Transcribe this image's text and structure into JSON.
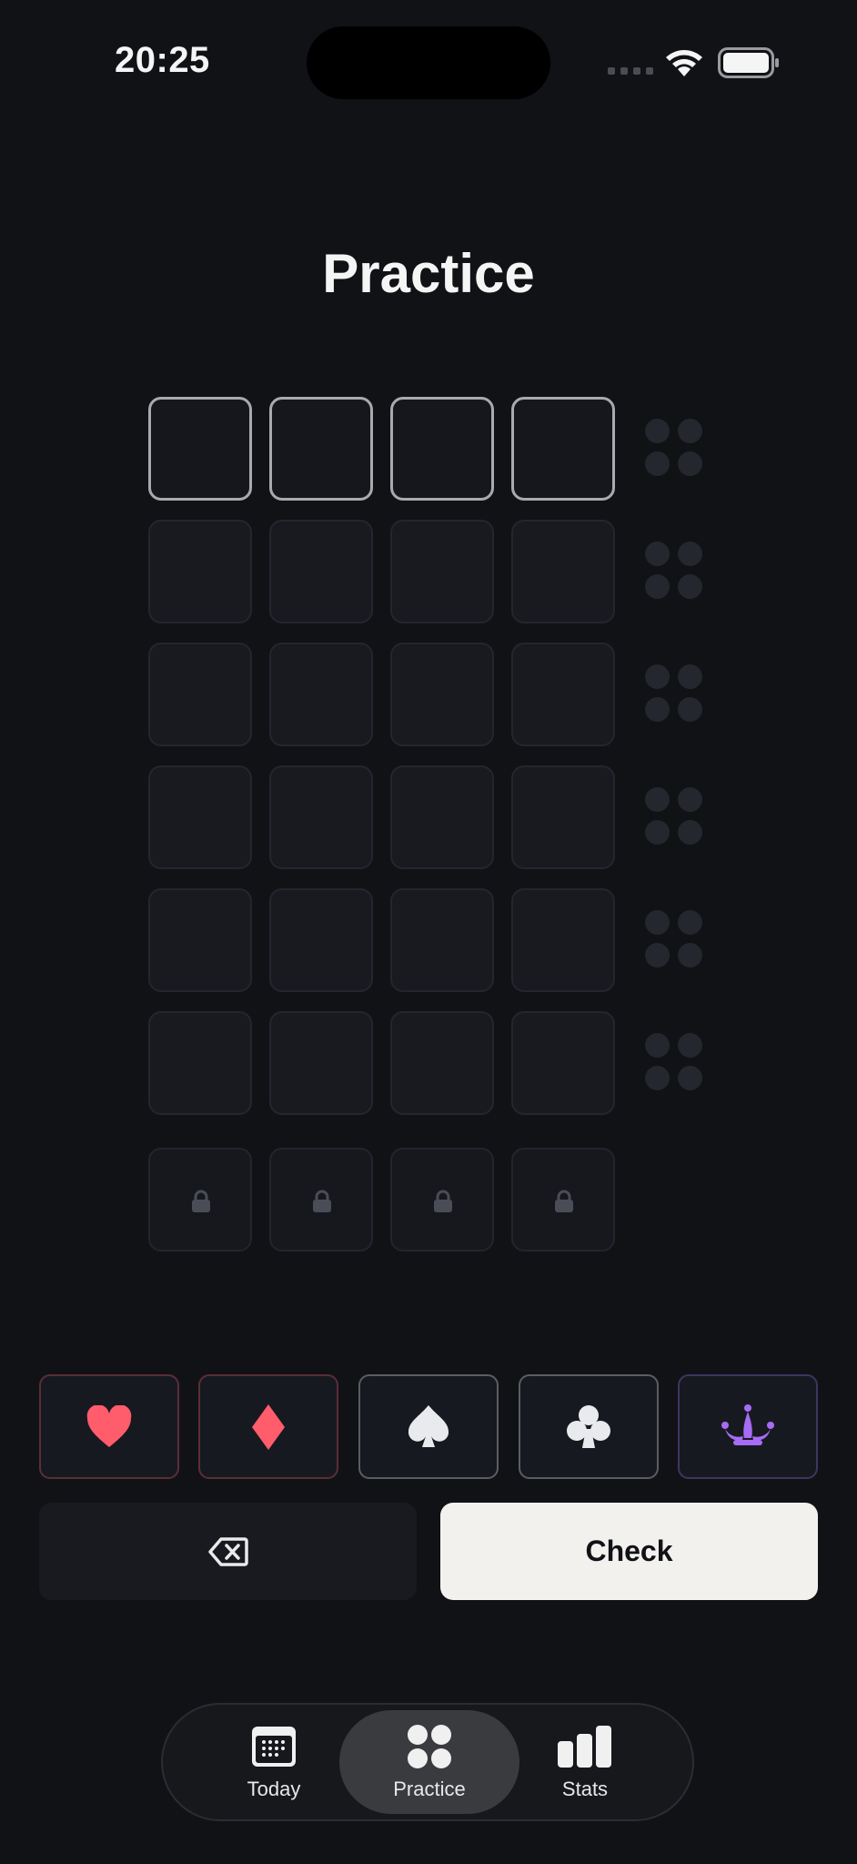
{
  "status_bar": {
    "time": "20:25"
  },
  "page": {
    "title": "Practice"
  },
  "board": {
    "rows": 6,
    "columns": 4,
    "active_row": 1,
    "locked_row_count": 4
  },
  "suits": [
    {
      "name": "heart",
      "color": "#ff5c6c"
    },
    {
      "name": "diamond",
      "color": "#ff5c6c"
    },
    {
      "name": "spade",
      "color": "#e9eaee"
    },
    {
      "name": "club",
      "color": "#e9eaee"
    },
    {
      "name": "joker-crown",
      "color": "#a66cf5"
    }
  ],
  "actions": {
    "backspace_icon": "backspace-icon",
    "check_label": "Check"
  },
  "tabs": [
    {
      "label": "Today",
      "icon": "calendar-icon",
      "selected": false
    },
    {
      "label": "Practice",
      "icon": "four-dots-icon",
      "selected": true
    },
    {
      "label": "Stats",
      "icon": "bar-chart-icon",
      "selected": false
    }
  ],
  "colors": {
    "background": "#111216",
    "accent_red": "#ff5c6c",
    "accent_purple": "#a66cf5",
    "check_button": "#f2f1ed"
  }
}
